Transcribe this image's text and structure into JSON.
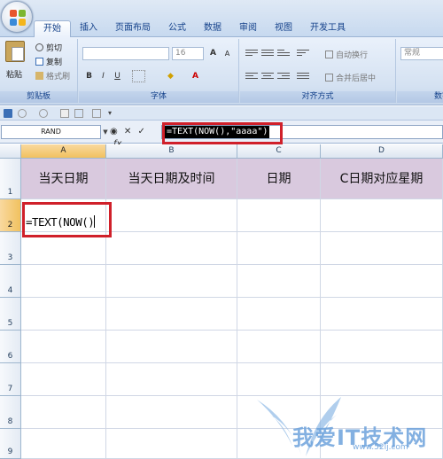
{
  "tabs": [
    {
      "label": "开始",
      "active": true
    },
    {
      "label": "插入"
    },
    {
      "label": "页面布局"
    },
    {
      "label": "公式"
    },
    {
      "label": "数据"
    },
    {
      "label": "审阅"
    },
    {
      "label": "视图"
    },
    {
      "label": "开发工具"
    }
  ],
  "ribbon": {
    "clipboard": {
      "paste": "粘贴",
      "cut": "剪切",
      "copy": "复制",
      "format_painter": "格式刷",
      "group_label": "剪贴板"
    },
    "font": {
      "size": "16",
      "bold": "B",
      "italic": "I",
      "underline": "U",
      "grow": "A",
      "shrink": "A",
      "color_a": "A",
      "group_label": "字体"
    },
    "alignment": {
      "wrap_text": "自动换行",
      "merge_center": "合并后居中",
      "group_label": "对齐方式"
    },
    "number": {
      "format": "常规",
      "group_label": "数字"
    }
  },
  "formula_bar": {
    "name_box": "RAND",
    "formula": "=TEXT(NOW(),\"aaaa\")",
    "fx": "fx"
  },
  "columns": [
    "A",
    "B",
    "C",
    "D"
  ],
  "rows": [
    "1",
    "2",
    "3",
    "4",
    "5",
    "6",
    "7",
    "8",
    "9"
  ],
  "header_row": [
    "当天日期",
    "当天日期及时间",
    "日期",
    "C日期对应星期"
  ],
  "editing_cell": {
    "ref": "A2",
    "text": "=TEXT(NOW()"
  },
  "watermark": {
    "text": "我爱IT技术网",
    "url": "www.52ij.com"
  },
  "colors": {
    "header_fill": "#d9c9de",
    "highlight_red": "#d0202a",
    "ribbon_blue": "#15428b"
  }
}
